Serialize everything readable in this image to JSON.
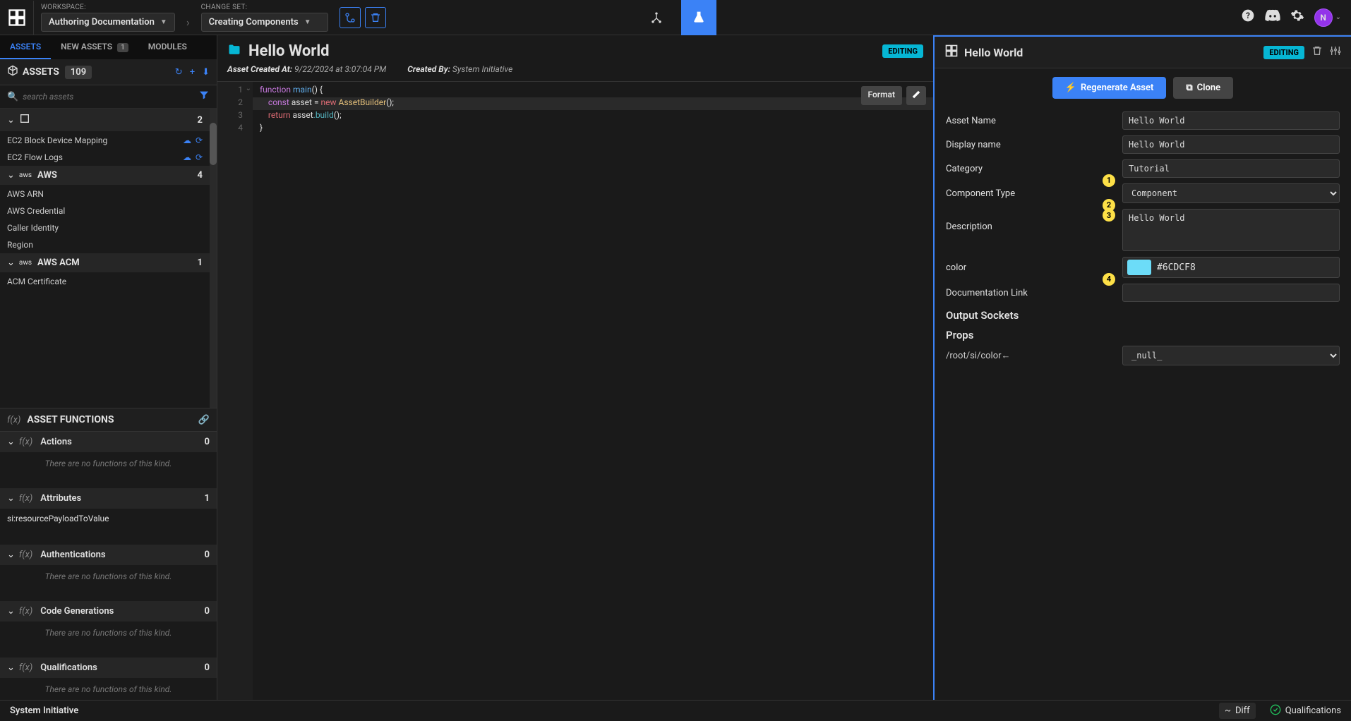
{
  "topbar": {
    "workspace_label": "WORKSPACE:",
    "workspace_value": "Authoring Documentation",
    "changeset_label": "CHANGE SET:",
    "changeset_value": "Creating Components",
    "avatar_initial": "N"
  },
  "tabs": {
    "assets": "ASSETS",
    "new_assets": "NEW ASSETS",
    "new_assets_count": "1",
    "modules": "MODULES"
  },
  "assets_panel": {
    "title": "ASSETS",
    "count": "109",
    "search_placeholder": "search assets"
  },
  "tree": {
    "group0_count": "2",
    "item0": "EC2 Block Device Mapping",
    "item1": "EC2 Flow Logs",
    "group1_name": "AWS",
    "group1_count": "4",
    "item2": "AWS ARN",
    "item3": "AWS Credential",
    "item4": "Caller Identity",
    "item5": "Region",
    "group2_name": "AWS ACM",
    "group2_count": "1",
    "item6": "ACM Certificate"
  },
  "asset_functions": {
    "title": "ASSET FUNCTIONS",
    "groups": {
      "actions": {
        "name": "Actions",
        "count": "0"
      },
      "attributes": {
        "name": "Attributes",
        "count": "1",
        "item": "si:resourcePayloadToValue"
      },
      "auth": {
        "name": "Authentications",
        "count": "0"
      },
      "codegen": {
        "name": "Code Generations",
        "count": "0"
      },
      "qual": {
        "name": "Qualifications",
        "count": "0"
      }
    },
    "empty_msg": "There are no functions of this kind."
  },
  "center": {
    "title": "Hello World",
    "editing": "EDITING",
    "created_at_label": "Asset Created At:",
    "created_at_value": "9/22/2024 at 3:07:04 PM",
    "created_by_label": "Created By:",
    "created_by_value": "System Initiative",
    "format_btn": "Format",
    "code": {
      "l1_kw": "function",
      "l1_fn": "main",
      "l1_rest": "() {",
      "l2_kw": "const",
      "l2_var": "asset",
      "l2_eq": " = ",
      "l2_new": "new",
      "l2_cls": " AssetBuilder",
      "l2_rest": "();",
      "l3_kw": "return",
      "l3_var": " asset",
      "l3_prop": ".build",
      "l3_rest": "();",
      "l4": "}"
    }
  },
  "right": {
    "title": "Hello World",
    "editing": "EDITING",
    "regenerate": "Regenerate Asset",
    "clone": "Clone",
    "fields": {
      "asset_name": {
        "label": "Asset Name",
        "value": "Hello World"
      },
      "display_name": {
        "label": "Display name",
        "value": "Hello World"
      },
      "category": {
        "label": "Category",
        "value": "Tutorial",
        "annot": "1"
      },
      "component_type": {
        "label": "Component Type",
        "value": "Component",
        "annot": "2"
      },
      "description": {
        "label": "Description",
        "value": "Hello World",
        "annot": "3"
      },
      "color": {
        "label": "color",
        "value": "#6CDCF8",
        "annot": "4"
      },
      "doc_link": {
        "label": "Documentation Link",
        "value": ""
      }
    },
    "output_sockets": "Output Sockets",
    "props": "Props",
    "prop_path": "/root/si/color←",
    "prop_value": "_null_"
  },
  "footer": {
    "brand": "System Initiative",
    "diff": "Diff",
    "qual": "Qualifications"
  }
}
